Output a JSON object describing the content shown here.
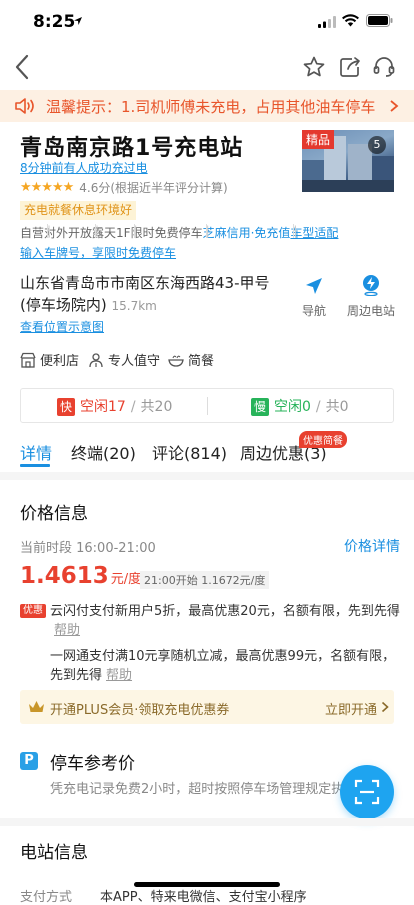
{
  "status": {
    "time": "8:25"
  },
  "notice": {
    "text": "温馨提示：1.司机师傅未充电，占用其他油车停车位..."
  },
  "station": {
    "name": "青岛南京路1号充电站",
    "recent": "8分钟前有人成功充过电",
    "stars": "★★★★★",
    "rating": "4.6分(根据近半年评分计算)",
    "tag": "充电就餐休息环境好",
    "photo_badge": "精品",
    "photo_count": "5",
    "features": [
      "自营",
      "对外开放",
      "露天1F",
      "限时免费停车"
    ],
    "feature_blue": "芝麻信用·免充值",
    "feature_link": "车型适配",
    "plate_prompt": "输入车牌号，享限时免费停车",
    "address": "山东省青岛市市南区东海西路43-甲号(停车场院内)",
    "distance": "15.7km",
    "map_link": "查看位置示意图",
    "nav_label": "导航",
    "nearby_label": "周边电站"
  },
  "amenities": [
    "便利店",
    "专人值守",
    "简餐"
  ],
  "availability": {
    "fast_badge": "快",
    "fast_free": "空闲17",
    "fast_total": "共20",
    "slow_badge": "慢",
    "slow_free": "空闲0",
    "slow_total": "共0",
    "slash": "/"
  },
  "tabs": [
    "详情",
    "终端(20)",
    "评论(814)",
    "周边优惠(3)"
  ],
  "promo_badge": "优惠简餐",
  "price": {
    "section": "价格信息",
    "period": "当前时段 16:00-21:00",
    "detail_link": "价格详情",
    "value": "1.4613",
    "unit": "元/度",
    "next": "21:00开始 1.1672元/度",
    "discount_tag": "优惠",
    "discount1": "云闪付支付新用户5折，最高优惠20元，名额有限，先到先得",
    "discount2": "一网通支付满10元享随机立减，最高优惠99元，名额有限，先到先得",
    "help": "帮助",
    "plus_text": "开通PLUS会员·领取充电优惠券",
    "plus_action": "立即开通"
  },
  "parking": {
    "icon": "P",
    "title": "停车参考价",
    "desc": "凭充电记录免费2小时，超时按照停车场管理规定执行"
  },
  "info": {
    "section": "电站信息",
    "pay_label": "支付方式",
    "pay_values": "本APP、特来电微信、支付宝小程序"
  },
  "colors": {
    "accent": "#1a8fe0",
    "price": "#e8412f",
    "fast": "#e8412f",
    "slow": "#27b35a"
  }
}
